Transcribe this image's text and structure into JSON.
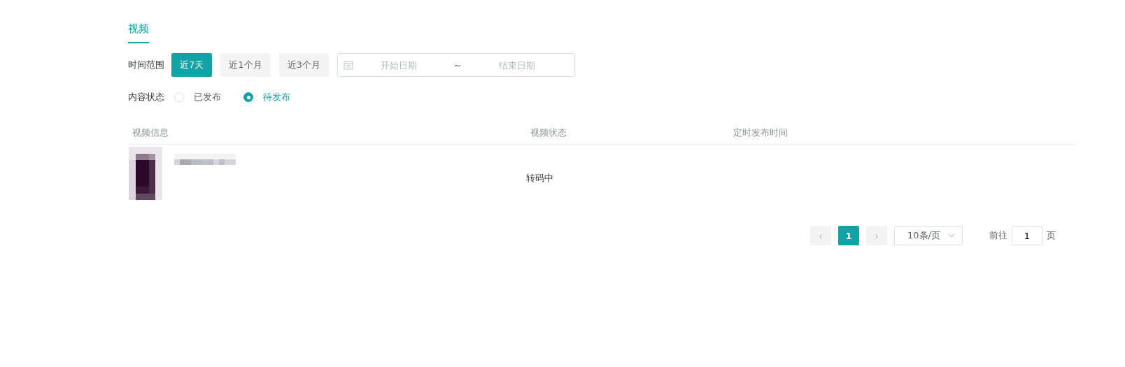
{
  "tabs": [
    {
      "label": "视频",
      "selected": true
    }
  ],
  "time_range": {
    "label": "时间范围",
    "options": [
      {
        "label": "近7天",
        "selected": true
      },
      {
        "label": "近1个月",
        "selected": false
      },
      {
        "label": "近3个月",
        "selected": false
      }
    ],
    "start_placeholder": "开始日期",
    "separator": "~",
    "end_placeholder": "结束日期"
  },
  "content_status": {
    "label": "内容状态",
    "options": [
      {
        "label": "已发布",
        "selected": false
      },
      {
        "label": "待发布",
        "selected": true
      }
    ]
  },
  "table": {
    "columns": [
      "视频信息",
      "视频状态",
      "定时发布时间"
    ],
    "rows": [
      {
        "status": "转码中"
      }
    ]
  },
  "pagination": {
    "prev": "‹",
    "pages": [
      {
        "label": "1",
        "selected": true
      }
    ],
    "next": "›",
    "page_size": "10条/页",
    "goto_label": "前往",
    "goto_value": "1",
    "goto_suffix": "页"
  }
}
